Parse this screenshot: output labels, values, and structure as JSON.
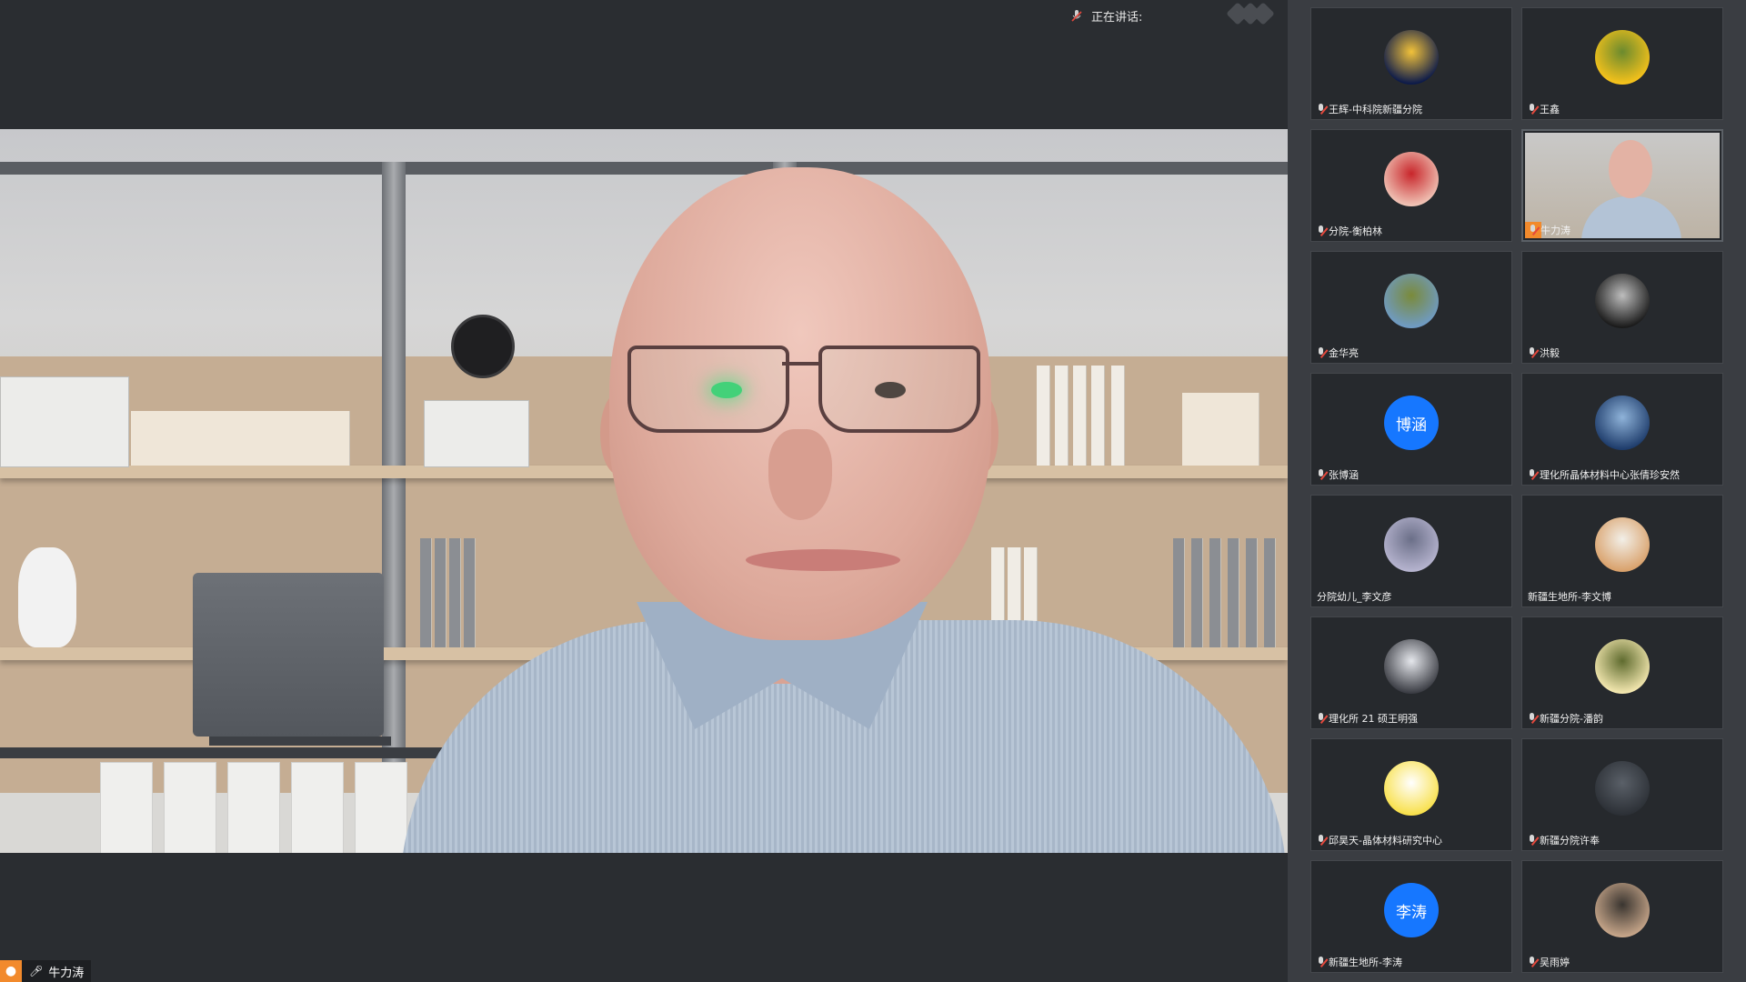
{
  "header": {
    "speaking_label": "正在讲话:"
  },
  "main_video": {
    "speaker_name": "牛力涛"
  },
  "participants": [
    {
      "name": "王辉-中科院新疆分院",
      "avatar": {
        "type": "image",
        "colors": [
          "#0c1a4a",
          "#f2c23a"
        ]
      },
      "muted": true
    },
    {
      "name": "王鑫",
      "avatar": {
        "type": "image",
        "colors": [
          "#f6c21b",
          "#6b8a2e"
        ]
      },
      "muted": true
    },
    {
      "name": "分院-衡柏林",
      "avatar": {
        "type": "image",
        "colors": [
          "#f0c4b6",
          "#c8262b"
        ]
      },
      "muted": true
    },
    {
      "name": "牛力涛",
      "avatar": {
        "type": "video"
      },
      "muted": false,
      "active": true
    },
    {
      "name": "金华亮",
      "avatar": {
        "type": "image",
        "colors": [
          "#6f9bc5",
          "#7a8a3a"
        ]
      },
      "muted": true
    },
    {
      "name": "洪毅",
      "avatar": {
        "type": "image",
        "colors": [
          "#1a1a1a",
          "#bdbdbd"
        ]
      },
      "muted": true
    },
    {
      "name": "张博涵",
      "avatar": {
        "type": "text",
        "text": "博涵",
        "colors": [
          "#1677ff"
        ]
      },
      "muted": true
    },
    {
      "name": "理化所晶体材料中心张倩珍安然",
      "avatar": {
        "type": "image",
        "colors": [
          "#1e3c6b",
          "#8fb3d9"
        ]
      },
      "muted": true
    },
    {
      "name": "分院幼儿_李文彦",
      "avatar": {
        "type": "image",
        "colors": [
          "#b6b4cf",
          "#6b6f88"
        ]
      },
      "muted": false
    },
    {
      "name": "新疆生地所-李文博",
      "avatar": {
        "type": "image",
        "colors": [
          "#d9a16b",
          "#f2efe8"
        ]
      },
      "muted": false
    },
    {
      "name": "理化所 21 硕王明强",
      "avatar": {
        "type": "image",
        "colors": [
          "#3b3d44",
          "#e5e7ec"
        ]
      },
      "muted": true
    },
    {
      "name": "新疆分院-潘韵",
      "avatar": {
        "type": "image",
        "colors": [
          "#f4e8b0",
          "#5f6b2f"
        ]
      },
      "muted": true
    },
    {
      "name": "邱昊天-晶体材料研究中心",
      "avatar": {
        "type": "image",
        "colors": [
          "#f8e04a",
          "#ffffff"
        ]
      },
      "muted": true
    },
    {
      "name": "新疆分院许奉",
      "avatar": {
        "type": "image",
        "colors": [
          "#2c3036",
          "#5a6068"
        ]
      },
      "muted": true
    },
    {
      "name": "新疆生地所-李涛",
      "avatar": {
        "type": "text",
        "text": "李涛",
        "colors": [
          "#1677ff"
        ]
      },
      "muted": true
    },
    {
      "name": "吴雨婷",
      "avatar": {
        "type": "image",
        "colors": [
          "#c7a68a",
          "#3a3530"
        ]
      },
      "muted": true
    }
  ]
}
